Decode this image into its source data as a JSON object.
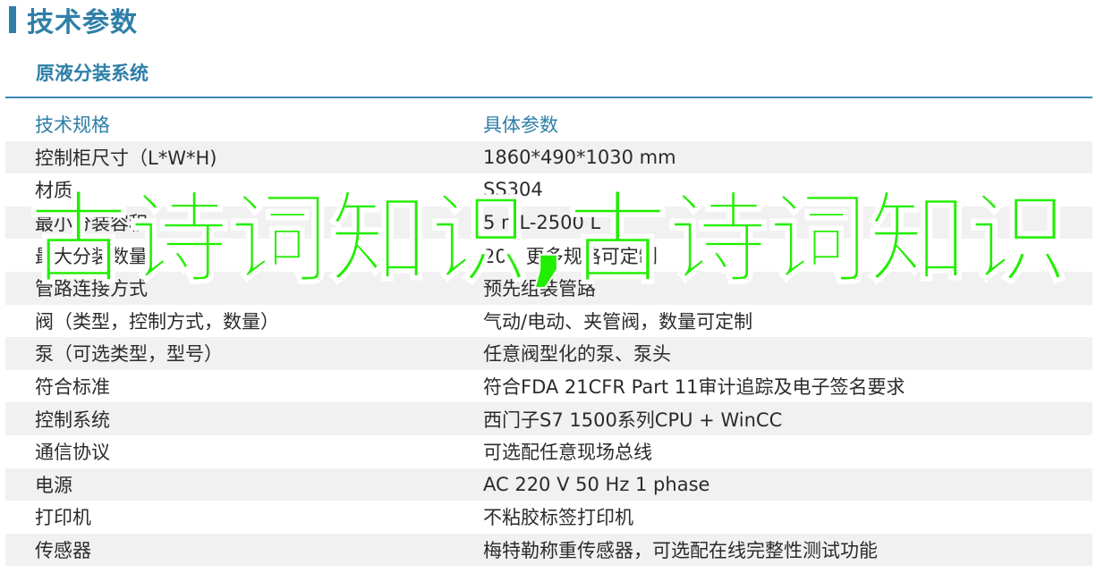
{
  "page": {
    "title": "技术参数"
  },
  "section": {
    "title": "原液分装系统"
  },
  "table": {
    "headers": {
      "name": "技术规格",
      "value": "具体参数"
    },
    "rows": [
      {
        "name": "控制柜尺寸（L*W*H)",
        "value": "1860*490*1030 mm"
      },
      {
        "name": "材质",
        "value": "SS304"
      },
      {
        "name": "最小分装容积",
        "value": "5 mL-2500 L"
      },
      {
        "name": "最大分装数量",
        "value": "20，更多规格可定制"
      },
      {
        "name": "管路连接方式",
        "value": "预先组装管路"
      },
      {
        "name": "阀（类型，控制方式，数量）",
        "value": "气动/电动、夹管阀，数量可定制"
      },
      {
        "name": "泵（可选类型，型号）",
        "value": "任意阀型化的泵、泵头"
      },
      {
        "name": "符合标准",
        "value": "符合FDA 21CFR Part 11审计追踪及电子签名要求"
      },
      {
        "name": "控制系统",
        "value": "西门子S7 1500系列CPU + WinCC"
      },
      {
        "name": "通信协议",
        "value": "可选配任意现场总线"
      },
      {
        "name": "电源",
        "value": "AC 220 V 50 Hz 1 phase"
      },
      {
        "name": "打印机",
        "value": "不粘胶标签打印机"
      },
      {
        "name": "传感器",
        "value": "梅特勒称重传感器，可选配在线完整性测试功能"
      }
    ]
  },
  "watermark": {
    "text": "古诗词知识,古诗词知识"
  },
  "colors": {
    "accent": "#2e7fa8",
    "row_alt": "#f1f1f1",
    "watermark": "#22ee00"
  }
}
